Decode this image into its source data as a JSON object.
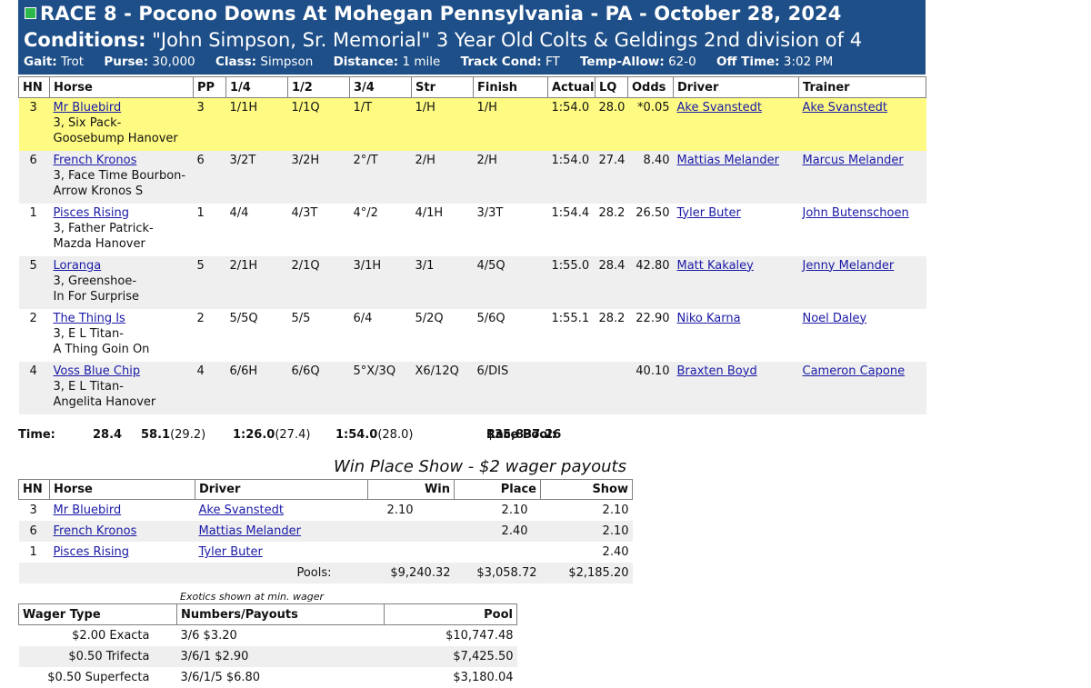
{
  "header": {
    "line1": "RACE 8 - Pocono Downs At Mohegan Pennsylvania - PA - October 28, 2024",
    "conditions_label": "Conditions:",
    "conditions_text": "\"John Simpson, Sr. Memorial\" 3 Year Old Colts & Geldings 2nd division of 4",
    "gait_label": "Gait:",
    "gait": "Trot",
    "purse_label": "Purse:",
    "purse": "30,000",
    "class_label": "Class:",
    "class": "Simpson",
    "distance_label": "Distance:",
    "distance": "1 mile",
    "track_label": "Track Cond:",
    "track": "FT",
    "temp_label": "Temp-Allow:",
    "temp": "62-0",
    "off_label": "Off Time:",
    "off": "3:02 PM"
  },
  "columns": {
    "hn": "HN",
    "horse": "Horse",
    "pp": "PP",
    "q1": "1/4",
    "q2": "1/2",
    "q3": "3/4",
    "str": "Str",
    "finish": "Finish",
    "actual": "Actual",
    "lq": "LQ",
    "odds": "Odds",
    "driver": "Driver",
    "trainer": "Trainer"
  },
  "results": [
    {
      "hn": "3",
      "horse": "Mr Bluebird",
      "age_sire": "3, Six Pack-",
      "dam": "Goosebump Hanover",
      "pp": "3",
      "q1": "1/1H",
      "q2": "1/1Q",
      "q3": "1/T",
      "str": "1/H",
      "finish": "1/H",
      "actual": "1:54.0",
      "lq": "28.0",
      "odds": "*0.05",
      "driver": "Ake Svanstedt",
      "trainer": "Ake Svanstedt"
    },
    {
      "hn": "6",
      "horse": "French Kronos",
      "age_sire": "3, Face Time Bourbon-",
      "dam": "Arrow Kronos S",
      "pp": "6",
      "q1": "3/2T",
      "q2": "3/2H",
      "q3": "2°/T",
      "str": "2/H",
      "finish": "2/H",
      "actual": "1:54.0",
      "lq": "27.4",
      "odds": "8.40",
      "driver": "Mattias Melander",
      "trainer": "Marcus Melander"
    },
    {
      "hn": "1",
      "horse": "Pisces Rising",
      "age_sire": "3, Father Patrick-",
      "dam": "Mazda Hanover",
      "pp": "1",
      "q1": "4/4",
      "q2": "4/3T",
      "q3": "4°/2",
      "str": "4/1H",
      "finish": "3/3T",
      "actual": "1:54.4",
      "lq": "28.2",
      "odds": "26.50",
      "driver": "Tyler Buter",
      "trainer": "John Butenschoen"
    },
    {
      "hn": "5",
      "horse": "Loranga",
      "age_sire": "3, Greenshoe-",
      "dam": "In For Surprise",
      "pp": "5",
      "q1": "2/1H",
      "q2": "2/1Q",
      "q3": "3/1H",
      "str": "3/1",
      "finish": "4/5Q",
      "actual": "1:55.0",
      "lq": "28.4",
      "odds": "42.80",
      "driver": "Matt Kakaley",
      "trainer": "Jenny Melander"
    },
    {
      "hn": "2",
      "horse": "The Thing Is",
      "age_sire": "3, E L Titan-",
      "dam": "A Thing Goin On",
      "pp": "2",
      "q1": "5/5Q",
      "q2": "5/5",
      "q3": "6/4",
      "str": "5/2Q",
      "finish": "5/6Q",
      "actual": "1:55.1",
      "lq": "28.2",
      "odds": "22.90",
      "driver": "Niko Karna",
      "trainer": "Noel Daley"
    },
    {
      "hn": "4",
      "horse": "Voss Blue Chip",
      "age_sire": "3, E L Titan-",
      "dam": "Angelita Hanover",
      "pp": "4",
      "q1": "6/6H",
      "q2": "6/6Q",
      "q3": "5°X/3Q",
      "str": "X6/12Q",
      "finish": "6/DIS",
      "actual": "",
      "lq": "",
      "odds": "40.10",
      "driver": "Braxten Boyd",
      "trainer": "Cameron Capone"
    }
  ],
  "times": {
    "label": "Time:",
    "q1": "28.4",
    "half": "58.1",
    "half_split": "(29.2)",
    "three_q": "1:26.0",
    "three_q_split": "(27.4)",
    "final": "1:54.0",
    "final_split": "(28.0)",
    "pool_label": "Race Pool:",
    "pool": "$35,837.26"
  },
  "wps": {
    "title": "Win Place Show - $2 wager payouts",
    "columns": {
      "hn": "HN",
      "horse": "Horse",
      "driver": "Driver",
      "win": "Win",
      "place": "Place",
      "show": "Show"
    },
    "rows": [
      {
        "hn": "3",
        "horse": "Mr Bluebird",
        "driver": "Ake Svanstedt",
        "win": "2.10",
        "place": "2.10",
        "show": "2.10"
      },
      {
        "hn": "6",
        "horse": "French Kronos",
        "driver": "Mattias Melander",
        "win": "",
        "place": "2.40",
        "show": "2.10"
      },
      {
        "hn": "1",
        "horse": "Pisces Rising",
        "driver": "Tyler Buter",
        "win": "",
        "place": "",
        "show": "2.40"
      }
    ],
    "pools_label": "Pools:",
    "win_pool": "$9,240.32",
    "place_pool": "$3,058.72",
    "show_pool": "$2,185.20"
  },
  "exotics": {
    "note": "Exotics shown at min. wager",
    "columns": {
      "type": "Wager Type",
      "numbers": "Numbers/Payouts",
      "pool": "Pool"
    },
    "rows": [
      {
        "type": "$2.00 Exacta",
        "numbers": "3/6 $3.20",
        "pool": "$10,747.48"
      },
      {
        "type": "$0.50 Trifecta",
        "numbers": "3/6/1 $2.90",
        "pool": "$7,425.50"
      },
      {
        "type": "$0.50 Superfecta",
        "numbers": "3/6/1/5 $6.80",
        "pool": "$3,180.04"
      }
    ]
  },
  "colors": {
    "header_bg": "#1e4f88",
    "winner_row": "#fffb82",
    "alt_row": "#efefef",
    "link": "#1a1aa6"
  }
}
